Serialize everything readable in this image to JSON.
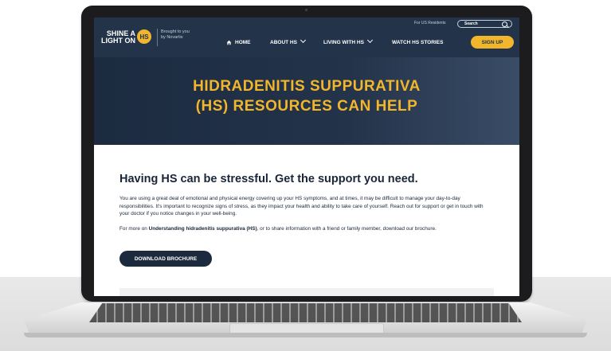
{
  "header": {
    "logo_line1": "SHINE A",
    "logo_line2": "LIGHT ON",
    "logo_badge": "HS",
    "brought_line1": "Brought to you",
    "brought_line2": "by Novartis",
    "residents": "For US Residents",
    "search_label": "Search",
    "search_icon": "search-icon"
  },
  "nav": {
    "home": "HOME",
    "home_icon": "home-icon",
    "about": "ABOUT HS",
    "living": "LIVING WITH HS",
    "watch": "WATCH HS STORIES",
    "signup": "SIGN UP"
  },
  "hero": {
    "title_line1": "HIDRADENITIS SUPPURATIVA",
    "title_line2": "(HS) RESOURCES CAN HELP"
  },
  "main": {
    "heading": "Having HS can be stressful. Get the support you need.",
    "paragraph1": "You are using a great deal of emotional and physical energy covering up your HS symptoms, and at times, it may be difficult to manage your day-to-day responsibilities. It's important to recognize signs of stress, as they impact your health and ability to take care of yourself. Reach out for support or get in touch with your doctor if you notice changes in your well-being.",
    "para2_before": "For more on ",
    "para2_link": "Understanding hidradenitis suppurativa (HS)",
    "para2_after": ", or to share information with a friend or family member, download our brochure.",
    "download_button": "DOWNLOAD BROCHURE"
  },
  "colors": {
    "navy": "#23334a",
    "accent": "#f2b62c"
  }
}
